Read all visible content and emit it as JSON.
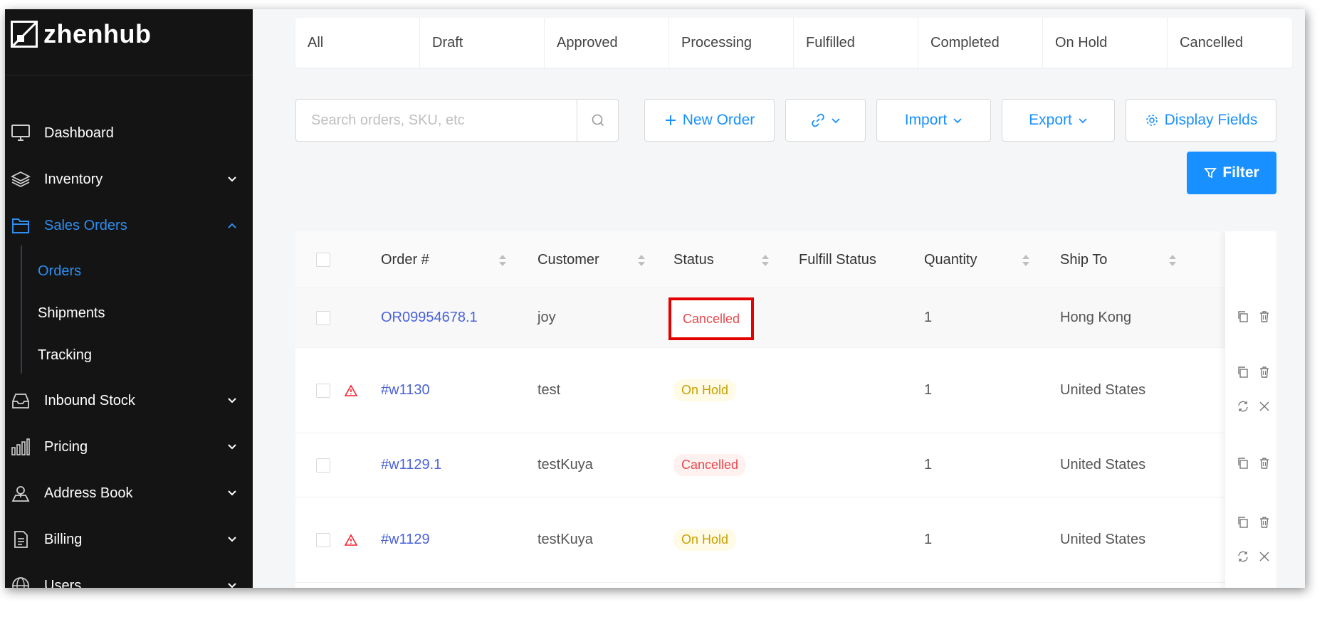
{
  "brand": {
    "name": "zhenhub"
  },
  "sidebar": {
    "items": [
      {
        "label": "Dashboard",
        "icon": "monitor-icon"
      },
      {
        "label": "Inventory",
        "icon": "layers-icon",
        "expandable": true
      },
      {
        "label": "Sales Orders",
        "icon": "folder-icon",
        "expandable": true,
        "active": true
      },
      {
        "label": "Inbound Stock",
        "icon": "inbox-icon",
        "expandable": true
      },
      {
        "label": "Pricing",
        "icon": "bar-chart-icon",
        "expandable": true
      },
      {
        "label": "Address Book",
        "icon": "map-pin-icon",
        "expandable": true
      },
      {
        "label": "Billing",
        "icon": "document-icon",
        "expandable": true
      },
      {
        "label": "Users",
        "icon": "globe-icon",
        "expandable": true
      }
    ],
    "sub_items": [
      {
        "label": "Orders",
        "active": true
      },
      {
        "label": "Shipments"
      },
      {
        "label": "Tracking"
      }
    ]
  },
  "tabs": [
    "All",
    "Draft",
    "Approved",
    "Processing",
    "Fulfilled",
    "Completed",
    "On Hold",
    "Cancelled"
  ],
  "search": {
    "placeholder": "Search orders, SKU, etc",
    "value": ""
  },
  "toolbar": {
    "new_order": "New Order",
    "import": "Import",
    "export": "Export",
    "display_fields": "Display Fields",
    "filter": "Filter"
  },
  "table": {
    "columns": [
      "Order #",
      "Customer",
      "Status",
      "Fulfill Status",
      "Quantity",
      "Ship To"
    ],
    "rows": [
      {
        "order": "OR09954678.1",
        "customer": "joy",
        "status": "Cancelled",
        "fulfill_status": "",
        "quantity": "1",
        "ship_to": "Hong Kong",
        "warning": false
      },
      {
        "order": "#w1130",
        "customer": "test",
        "status": "On Hold",
        "fulfill_status": "",
        "quantity": "1",
        "ship_to": "United States",
        "warning": true
      },
      {
        "order": "#w1129.1",
        "customer": "testKuya",
        "status": "Cancelled",
        "fulfill_status": "",
        "quantity": "1",
        "ship_to": "United States",
        "warning": false
      },
      {
        "order": "#w1129",
        "customer": "testKuya",
        "status": "On Hold",
        "fulfill_status": "",
        "quantity": "1",
        "ship_to": "United States",
        "warning": true
      }
    ]
  },
  "colors": {
    "accent": "#1890ff",
    "sidebar_bg": "#141414",
    "link": "#4a62d8",
    "highlight": "#e50000"
  }
}
